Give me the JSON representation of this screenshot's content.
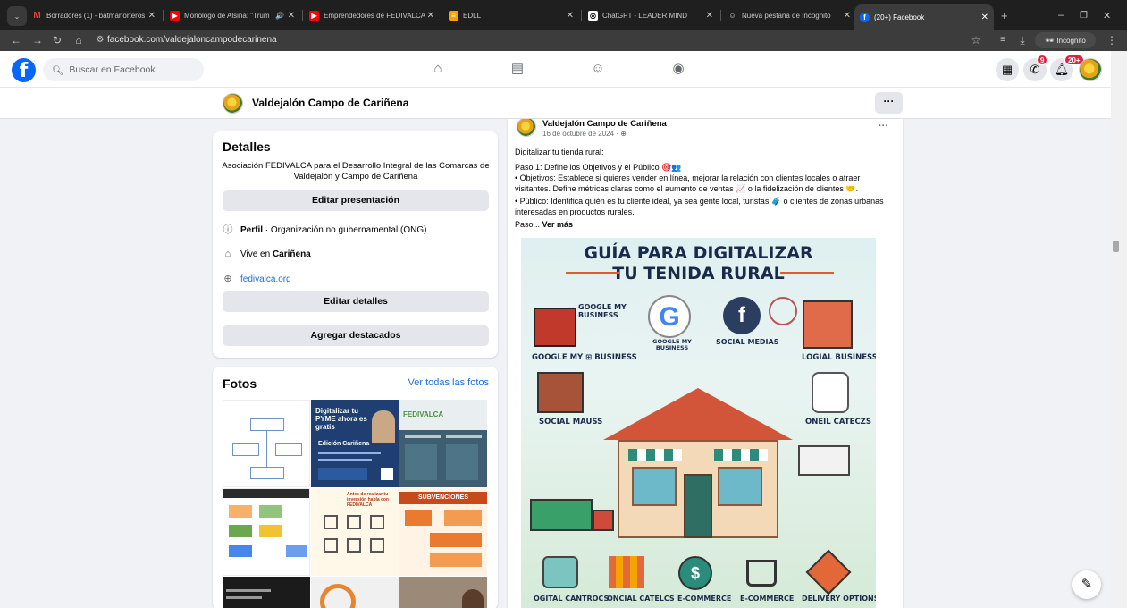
{
  "browser": {
    "tabs": [
      {
        "label": "Borradores (1) - batmanorteros",
        "fav": "M",
        "color": "#ea4335"
      },
      {
        "label": "Monólogo de Alsina: \"Trum",
        "fav": "▶",
        "color": "#ff0000"
      },
      {
        "label": "Emprendedores de FEDIVALCA",
        "fav": "▶",
        "color": "#ff0000"
      },
      {
        "label": "EDLL",
        "fav": "≡",
        "color": "#f4a300"
      },
      {
        "label": "ChatGPT - LEADER MIND",
        "fav": "◎",
        "color": "#555555"
      },
      {
        "label": "Nueva pestaña de Incógnito",
        "fav": "☺",
        "color": "#444444"
      },
      {
        "label": "(20+) Facebook",
        "fav": "f",
        "color": "#0866ff"
      }
    ],
    "url": "facebook.com/valdejaloncampodecarinena",
    "incognito_label": "Incógnito"
  },
  "fb": {
    "search_placeholder": "Buscar en Facebook",
    "messenger_badge": "9",
    "notifications_badge": "20+"
  },
  "page": {
    "name": "Valdejalón Campo de Cariñena",
    "more": "···"
  },
  "details": {
    "title": "Detalles",
    "bio": "Asociación FEDIVALCA para el Desarrollo Integral de las Comarcas de Valdejalón y Campo de Cariñena",
    "edit_intro": "Editar presentación",
    "profile_label": "Perfil",
    "profile_type": " · Organización no gubernamental (ONG)",
    "lives_prefix": "Vive en ",
    "lives_city": "Cariñena",
    "website": "fedivalca.org",
    "edit_details": "Editar detalles",
    "add_featured": "Agregar destacados"
  },
  "photos": {
    "title": "Fotos",
    "see_all": "Ver todas las fotos",
    "items": [
      {
        "caption": ""
      },
      {
        "caption": "Digitalizar tu PYME ahora es gratis",
        "sub": "Edición Cariñena"
      },
      {
        "caption": "FEDIVALCA"
      },
      {
        "caption": ""
      },
      {
        "caption": "Antes de realizar tu inversión habla con FEDIVALCA"
      },
      {
        "caption": "SUBVENCIONES"
      }
    ]
  },
  "post": {
    "author": "Valdejalón Campo de Cariñena",
    "date": "16 de octubre de 2024 · ",
    "more": "···",
    "line1": "Digitalizar tu tienda rural:",
    "line2": "Paso 1: Define los Objetivos y el Público 🎯👥",
    "line3": "• Objetivos: Establece si quieres vender en línea, mejorar la relación con clientes locales o atraer visitantes. Define métricas claras como el aumento de ventas 📈 o la fidelización de clientes 🤝.",
    "line4": "• Público: Identifica quién es tu cliente ideal, ya sea gente local, turistas 🧳 o clientes de zonas urbanas interesadas en productos rurales.",
    "line5": "Paso...",
    "see_more": " Ver más",
    "image": {
      "title1": "GUÍA PARA DIGITALIZAR",
      "title2": "TU TENIDA RURAL",
      "lbl_google_top": "GOOGLE MY BUSINESS",
      "lbl_google_mid": "GOOGLE MY BUSINESS",
      "lbl_social_media": "SOCIAL MEDIAS",
      "lbl_google_left": "GOOGLE MY ⊞ BUSINESS",
      "lbl_logial": "LOGIAL BUSINESS",
      "lbl_social_mauss": "SOCIAL MAUSS",
      "lbl_oneil": "ONEIL CATECZS",
      "bottom": [
        "OGITAL CANTROCS",
        "ONCIAL CATELCS",
        "E-COMMERCE",
        "E-COMMERCE",
        "DELIVERY OPTIONS"
      ]
    }
  },
  "colors": {
    "fb_blue": "#0866ff",
    "accent_red": "#e41e3f"
  }
}
